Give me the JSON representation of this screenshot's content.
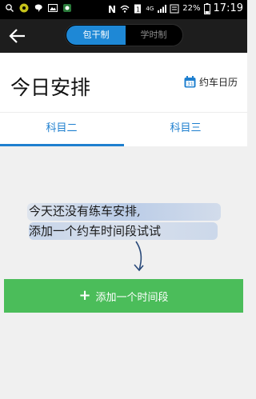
{
  "status_bar": {
    "battery_percent": "22%",
    "time": "17:19",
    "network": "4G"
  },
  "header": {
    "segment": {
      "left": "包干制",
      "right": "学时制",
      "selected": "包干制"
    }
  },
  "title_bar": {
    "title": "今日安排",
    "calendar_link": "约车日历"
  },
  "tabs": [
    {
      "label": "科目二",
      "selected": true
    },
    {
      "label": "科目三",
      "selected": false
    }
  ],
  "empty_state": {
    "line1": "今天还没有练车安排,",
    "line2": "添加一个约车时间段试试"
  },
  "add_button": {
    "label": "添加一个时间段"
  },
  "colors": {
    "accent_blue": "#1e7fcf",
    "segment_blue": "#1e88d6",
    "add_green": "#4bbd5a"
  }
}
